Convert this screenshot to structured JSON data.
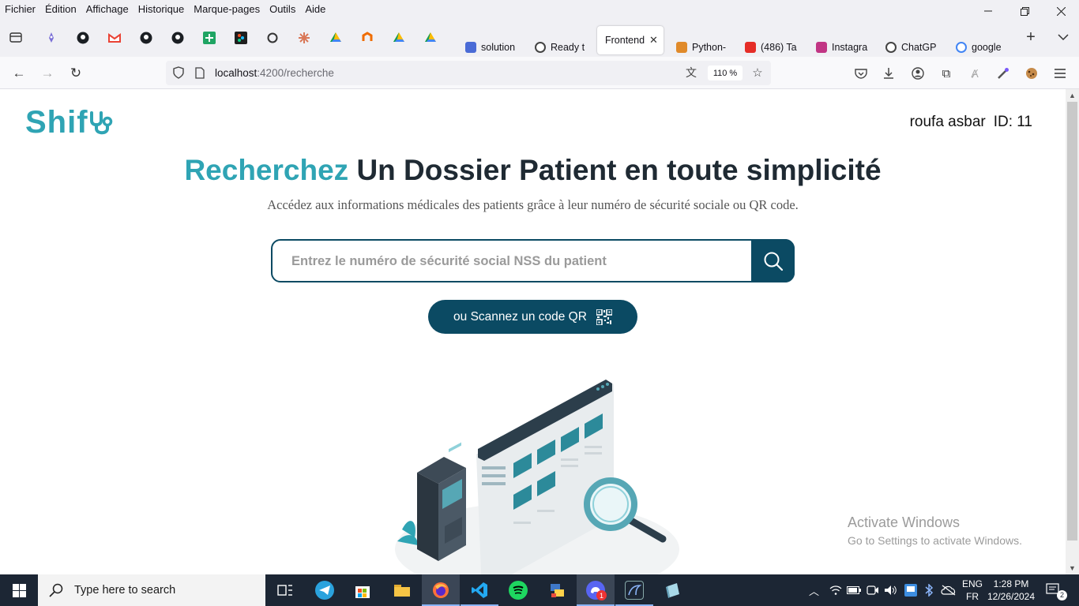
{
  "menu": [
    "Fichier",
    "Édition",
    "Affichage",
    "Historique",
    "Marque-pages",
    "Outils",
    "Aide"
  ],
  "tabs": [
    {
      "label": "solution",
      "color": "#4a6bd6"
    },
    {
      "label": "Ready t",
      "color": "#444444"
    },
    {
      "label": "Frontend",
      "color": "#ffffff",
      "active": true
    },
    {
      "label": "Python-",
      "color": "#e08a2a"
    },
    {
      "label": "(486) Ta",
      "color": "#e52d27"
    },
    {
      "label": "Instagra",
      "color": "#c13584"
    },
    {
      "label": "ChatGP",
      "color": "#444444"
    },
    {
      "label": "google",
      "color": "#4285f4"
    }
  ],
  "url": {
    "host": "localhost",
    "path": ":4200/recherche",
    "zoom": "110 %"
  },
  "header": {
    "logo": "Shif",
    "user_name": "roufa asbar",
    "user_id": "ID: 11"
  },
  "hero": {
    "accent": "Recherchez",
    "title_rest": " Un Dossier Patient en toute simplicité",
    "subtitle": "Accédez aux informations médicales des patients grâce à leur numéro de sécurité sociale ou QR code."
  },
  "search": {
    "placeholder": "Entrez le numéro de sécurité social NSS du patient",
    "value": ""
  },
  "qr_button": "ou Scannez un code QR",
  "watermark": {
    "line1": "Activate Windows",
    "line2": "Go to Settings to activate Windows."
  },
  "taskbar": {
    "search_label": "Type here to search",
    "lang_top": "ENG",
    "lang_bottom": "FR",
    "time": "1:28 PM",
    "date": "12/26/2024",
    "notifications": "2",
    "discord_badge": "1"
  },
  "colors": {
    "accent": "#2fa4b4",
    "primary": "#0b4a63",
    "taskbar": "#1c2634"
  }
}
